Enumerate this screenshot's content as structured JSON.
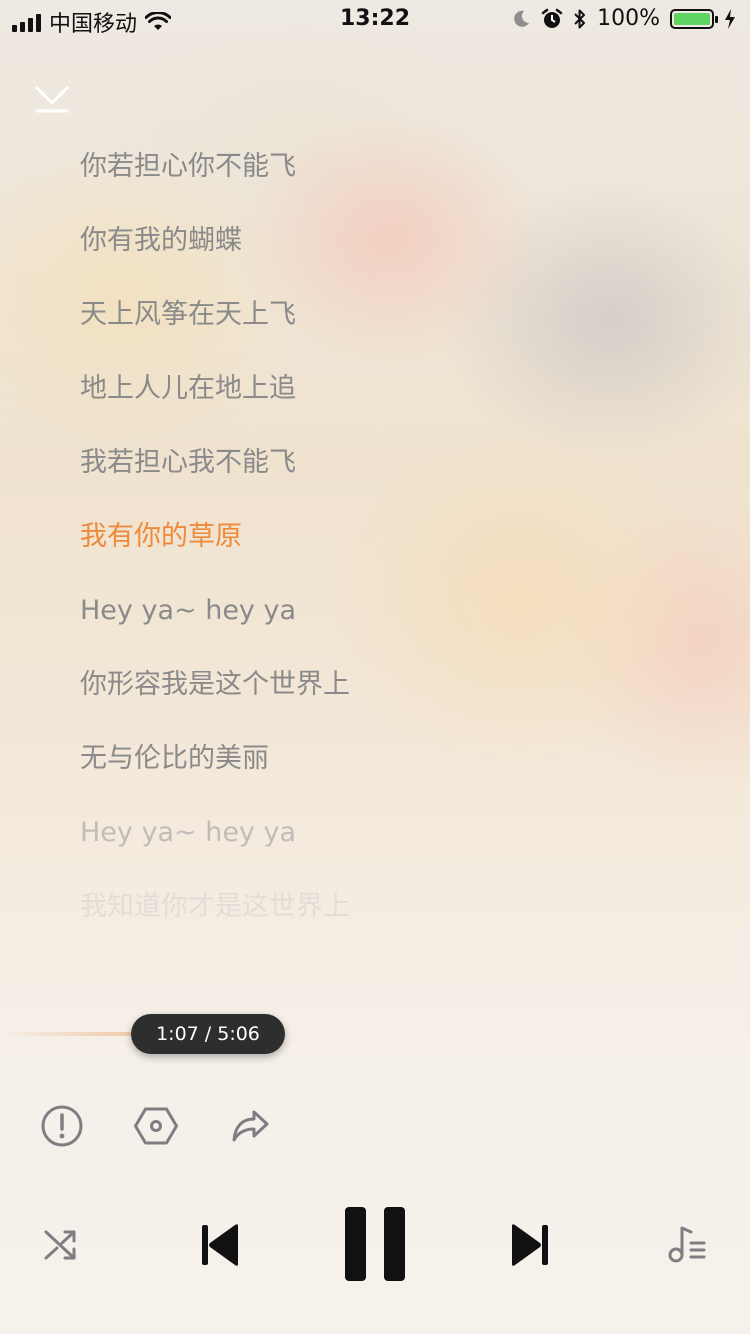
{
  "status_bar": {
    "carrier": "中国移动",
    "time": "13:22",
    "battery_percent": "100%",
    "battery_level": 1.0,
    "icons": [
      "signal-icon",
      "wifi-icon",
      "moon-icon",
      "alarm-icon",
      "bluetooth-icon",
      "battery-icon",
      "charging-icon"
    ]
  },
  "lyrics": {
    "lines": [
      {
        "text": "你若担心你不能飞"
      },
      {
        "text": "你有我的蝴蝶"
      },
      {
        "text": "天上风筝在天上飞"
      },
      {
        "text": "地上人儿在地上追"
      },
      {
        "text": "我若担心我不能飞"
      },
      {
        "text": "我有你的草原",
        "active": true
      },
      {
        "text": "Hey ya~ hey ya"
      },
      {
        "text": "你形容我是这个世界上"
      },
      {
        "text": "无与伦比的美丽"
      },
      {
        "text": "Hey ya~ hey ya"
      },
      {
        "text": "我知道你才是这世界上"
      }
    ],
    "active_color": "#ef8a3b"
  },
  "player": {
    "time_display": "1:07 / 5:06",
    "progress_fraction": 0.219
  },
  "actions": {
    "icons": [
      "report-icon",
      "settings-hexagon-icon",
      "share-icon"
    ]
  },
  "controls": {
    "icons": [
      "shuffle-icon",
      "previous-icon",
      "pause-icon",
      "next-icon",
      "playlist-icon"
    ]
  }
}
